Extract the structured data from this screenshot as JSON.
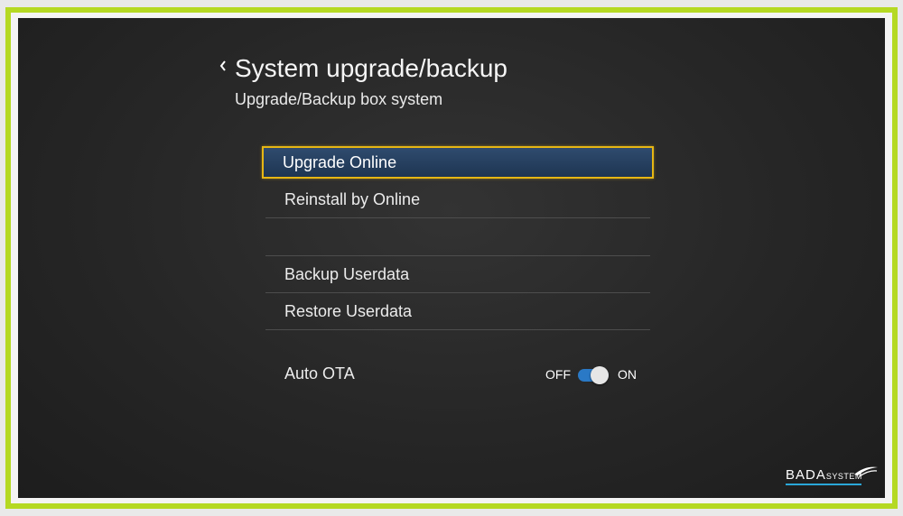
{
  "header": {
    "title": "System upgrade/backup",
    "subtitle": "Upgrade/Backup box system"
  },
  "menu": {
    "items": [
      {
        "label": "Upgrade Online"
      },
      {
        "label": "Reinstall by Online"
      },
      {
        "label": ""
      },
      {
        "label": "Backup Userdata"
      },
      {
        "label": "Restore Userdata"
      }
    ]
  },
  "auto_ota": {
    "label": "Auto OTA",
    "off_label": "OFF",
    "on_label": "ON",
    "state": "on"
  },
  "branding": {
    "name": "BADA",
    "suffix": "SYSTEM"
  },
  "colors": {
    "frame": "#b5d923",
    "selection_border": "#e6b614",
    "selection_fill": "#2f4b6e",
    "toggle_track": "#2a79c6"
  }
}
